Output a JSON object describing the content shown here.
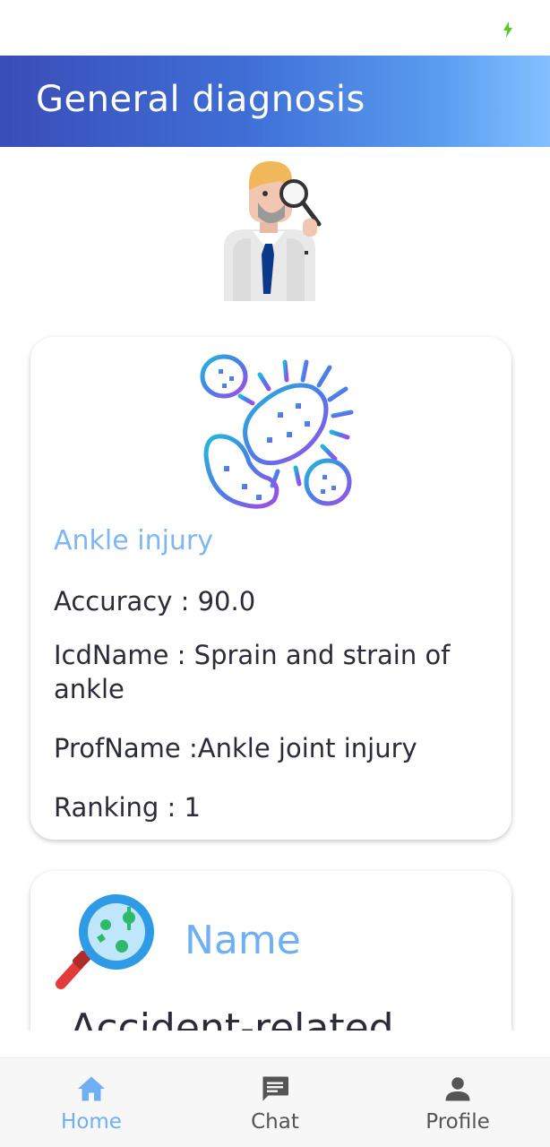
{
  "colors": {
    "accent": "#6fb0f5",
    "header_start": "#3a4db8",
    "header_end": "#84c0ff",
    "text": "#2b2b3a",
    "battery": "#5ac72a"
  },
  "status_bar": {
    "icons": [
      "battery-charging-icon"
    ]
  },
  "app_bar": {
    "title": "General diagnosis"
  },
  "illustration": {
    "icon": "doctor-magnifier-icon"
  },
  "cards": [
    {
      "icon": "bacteria-icon",
      "title": "Ankle injury",
      "accuracy": "Accuracy : 90.0",
      "icd_name": "IcdName : Sprain and strain of ankle",
      "prof_name": "ProfName :Ankle joint injury",
      "ranking": "Ranking : 1"
    },
    {
      "icon": "magnifier-germs-icon",
      "title": "Name",
      "value": "Accident-related"
    }
  ],
  "bottom_nav": {
    "items": [
      {
        "label": "Home",
        "icon": "home-icon",
        "active": true
      },
      {
        "label": "Chat",
        "icon": "chat-icon",
        "active": false
      },
      {
        "label": "Profile",
        "icon": "person-icon",
        "active": false
      }
    ]
  }
}
